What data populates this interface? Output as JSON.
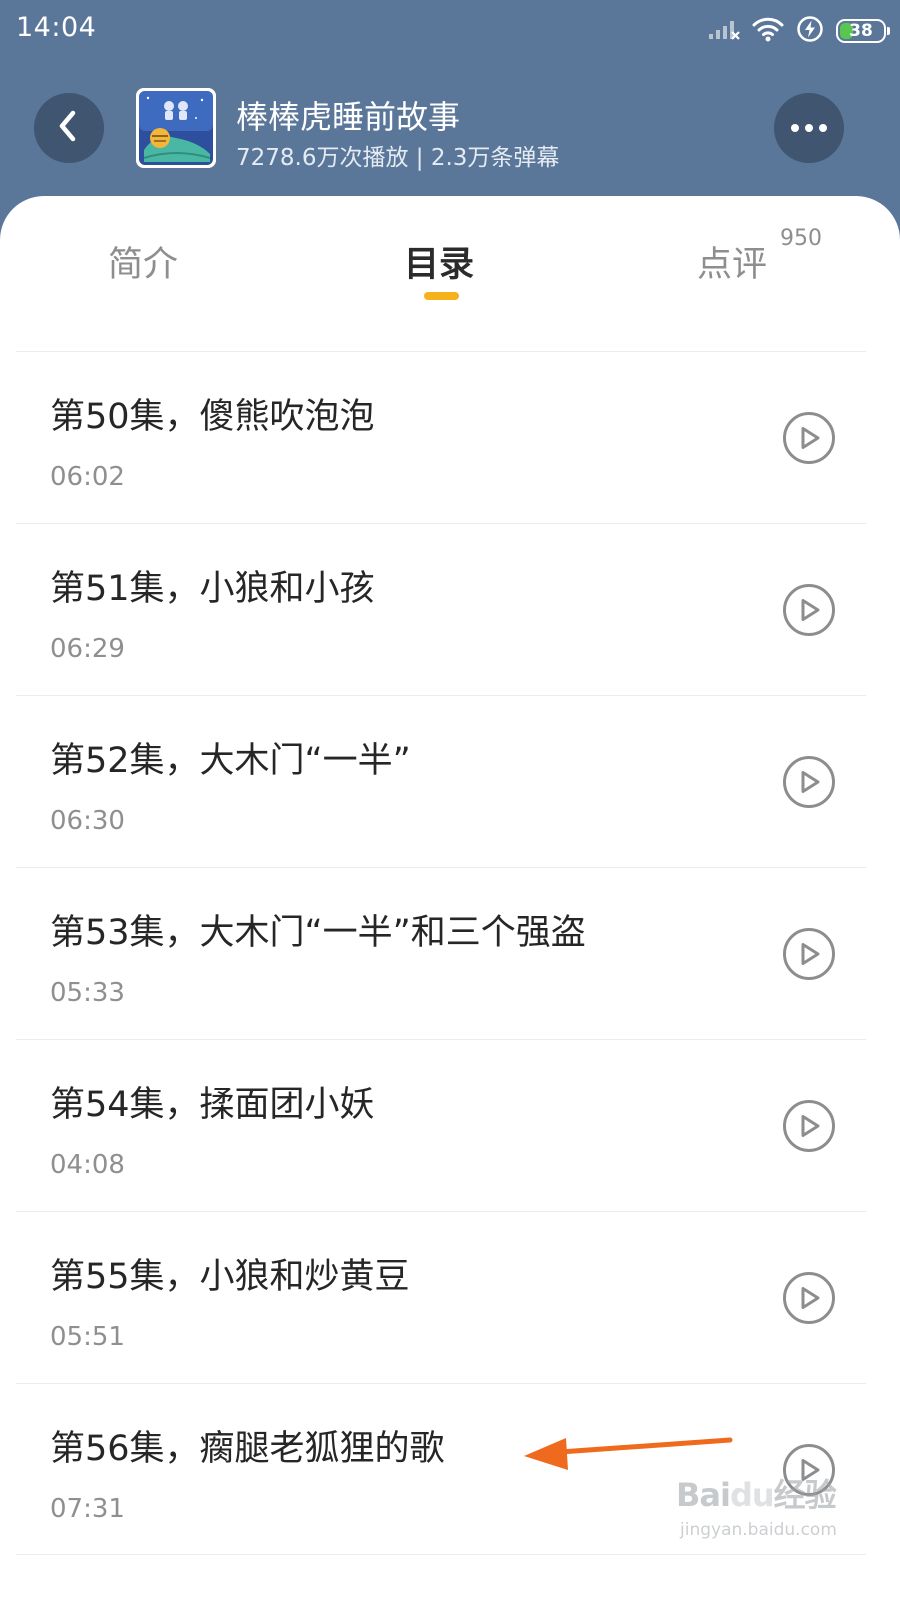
{
  "status_bar": {
    "time": "14:04",
    "battery_level": "38",
    "battery_fraction": 0.38,
    "icons": [
      "signal-off-icon",
      "wifi-icon",
      "charging-icon",
      "battery-icon"
    ]
  },
  "header": {
    "title": "棒棒虎睡前故事",
    "meta": "7278.6万次播放 | 2.3万条弹幕",
    "back_icon": "chevron-left-icon",
    "more_icon": "more-dots-icon"
  },
  "tabs": [
    {
      "label": "简介",
      "active": false
    },
    {
      "label": "目录",
      "active": true
    },
    {
      "label": "点评",
      "active": false,
      "badge": "950"
    }
  ],
  "episodes": [
    {
      "title": "第50集，傻熊吹泡泡",
      "duration": "06:02"
    },
    {
      "title": "第51集，小狼和小孩",
      "duration": "06:29"
    },
    {
      "title": "第52集，大木门“一半”",
      "duration": "06:30"
    },
    {
      "title": "第53集，大木门“一半”和三个强盗",
      "duration": "05:33"
    },
    {
      "title": "第54集，揉面团小妖",
      "duration": "04:08"
    },
    {
      "title": "第55集，小狼和炒黄豆",
      "duration": "05:51"
    },
    {
      "title": "第56集，瘸腿老狐狸的歌",
      "duration": "07:31"
    }
  ],
  "watermark": {
    "logo_prefix": "Bai",
    "logo_paw": "du",
    "logo_suffix": "经验",
    "url": "jingyan.baidu.com"
  },
  "colors": {
    "header_bg": "#5a7699",
    "button_bg": "#3f5570",
    "tab_indicator": "#f5b21a",
    "annotation_arrow": "#f06a1e",
    "battery_fill": "#59c64f"
  }
}
